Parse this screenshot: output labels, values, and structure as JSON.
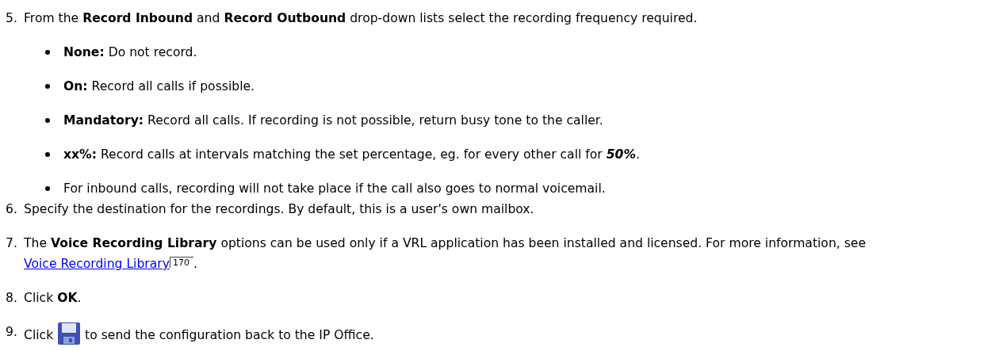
{
  "steps": [
    {
      "number": "5.",
      "parts": [
        {
          "kind": "text",
          "text": "From the **Record Inbound** and **Record Outbound** drop-down lists select the recording frequency required."
        }
      ],
      "bullets": [
        {
          "text": "**None:** Do not record."
        },
        {
          "text": "**On:** Record all calls if possible."
        },
        {
          "text": "**Mandatory:** Record all calls. If recording is not possible, return busy tone to the caller."
        },
        {
          "text": "**xx%:** Record calls at intervals matching the set percentage, eg. for every other call for",
          "emphasis": "50%",
          "after": "."
        },
        {
          "text": "For inbound calls, recording will not take place if the call also goes to normal voicemail."
        }
      ]
    },
    {
      "number": "6.",
      "parts": [
        {
          "kind": "text",
          "text": "Specify the destination for the recordings. By default, this is a user's own mailbox."
        }
      ]
    },
    {
      "number": "7.",
      "parts": [
        {
          "kind": "text",
          "text": "The **Voice Recording Library** options can be used only if a VRL application has been installed and licensed. For more information, see"
        },
        {
          "kind": "link",
          "text": "Voice Recording Library"
        },
        {
          "kind": "pageref",
          "text": "170"
        },
        {
          "kind": "text",
          "text": "."
        }
      ]
    },
    {
      "number": "8.",
      "parts": [
        {
          "kind": "text",
          "text": "Click **OK**."
        }
      ]
    },
    {
      "number": "9.",
      "parts": [
        {
          "kind": "text",
          "text": "Click"
        },
        {
          "kind": "icon"
        },
        {
          "kind": "text",
          "text": "to send the configuration back to the IP Office."
        }
      ]
    }
  ]
}
